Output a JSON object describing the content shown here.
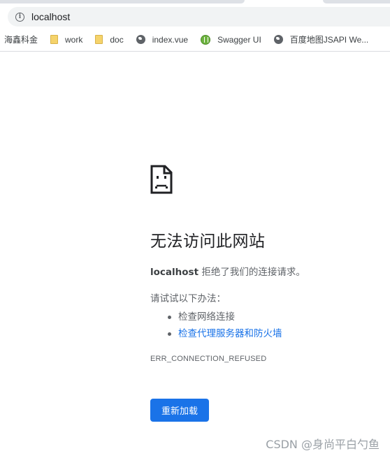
{
  "browser": {
    "url": "localhost",
    "bookmarks": [
      {
        "label": "海鑫科金",
        "icon": "none"
      },
      {
        "label": "work",
        "icon": "folder-icon"
      },
      {
        "label": "doc",
        "icon": "folder-icon"
      },
      {
        "label": "index.vue",
        "icon": "globe-icon"
      },
      {
        "label": "Swagger UI",
        "icon": "swagger-icon"
      },
      {
        "label": "百度地图JSAPI We...",
        "icon": "globe-icon"
      }
    ]
  },
  "error": {
    "title": "无法访问此网站",
    "host": "localhost",
    "message": " 拒绝了我们的连接请求。",
    "try_label": "请试试以下办法：",
    "suggestions": [
      {
        "text": "检查网络连接",
        "is_link": false
      },
      {
        "text": "检查代理服务器和防火墙",
        "is_link": true
      }
    ],
    "code": "ERR_CONNECTION_REFUSED",
    "reload_label": "重新加载"
  },
  "watermark": "CSDN @身尚平白勺鱼",
  "colors": {
    "accent": "#1a73e8",
    "text_secondary": "#5f6368",
    "omnibox_bg": "#f1f3f4"
  }
}
